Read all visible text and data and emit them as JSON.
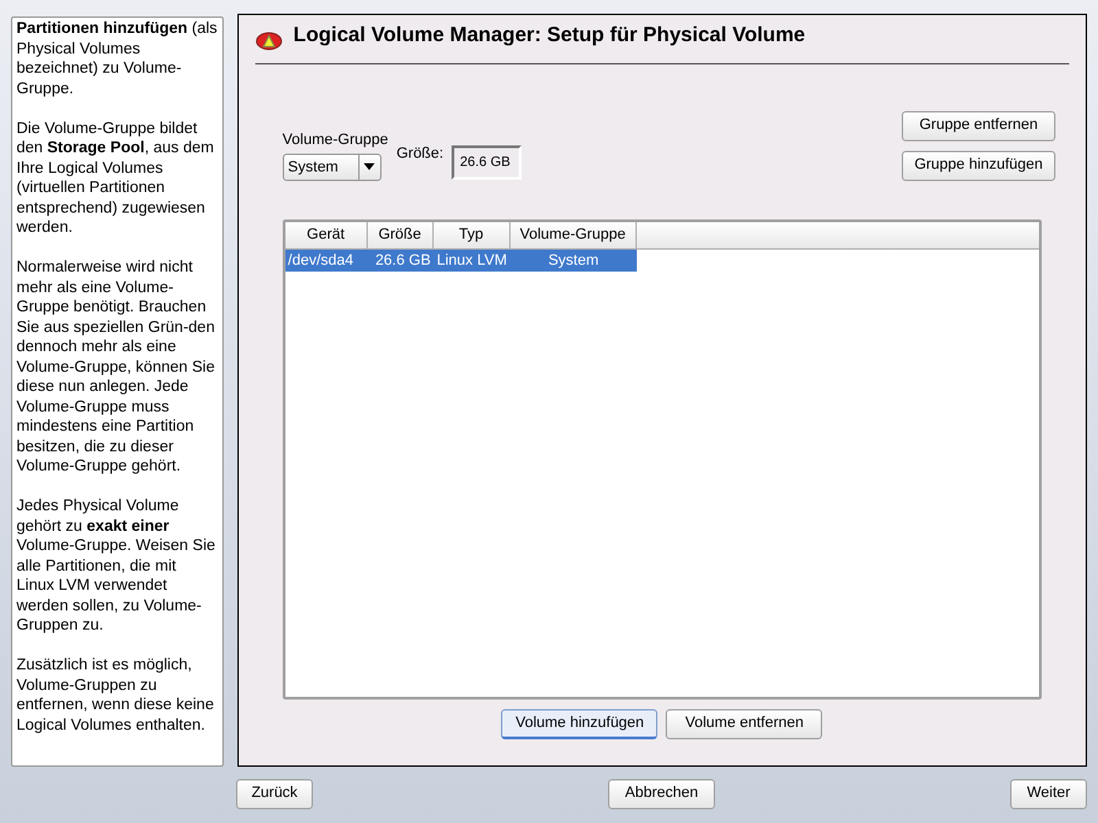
{
  "help": {
    "paragraphs": [
      "**Partitionen hinzufügen** (als Physical Volumes bezeichnet) zu Volume-Gruppe.",
      "Die Volume-Gruppe bildet den **Storage Pool**, aus dem Ihre Logical Volumes (virtuellen Partitionen entsprechend) zugewiesen werden.",
      "Normalerweise wird nicht mehr als eine Volume-Gruppe benötigt. Brauchen Sie aus speziellen Grün-den dennoch mehr als eine Volume-Gruppe, können Sie diese nun anlegen. Jede Volume-Gruppe muss mindestens eine Partition besitzen, die zu dieser Volume-Gruppe gehört.",
      "Jedes Physical Volume gehört zu **exakt einer** Volume-Gruppe. Weisen Sie alle Partitionen, die mit Linux LVM verwendet werden sollen, zu Volume-Gruppen zu.",
      "Zusätzlich ist es möglich, Volume-Gruppen zu entfernen, wenn diese keine Logical Volumes enthalten."
    ]
  },
  "dialog": {
    "title": "Logical Volume Manager: Setup für Physical Volume",
    "volume_group": {
      "label": "Volume-Gruppe",
      "value": "System"
    },
    "size": {
      "label": "Größe:",
      "value": "26.6 GB"
    },
    "group_buttons": [
      "Gruppe entfernen",
      "Gruppe hinzufügen"
    ],
    "table": {
      "columns": [
        "Gerät",
        "Größe",
        "Typ",
        "Volume-Gruppe"
      ],
      "rows": [
        {
          "cells": [
            "/dev/sda4",
            "26.6 GB",
            "Linux LVM",
            "System"
          ],
          "selected": true
        }
      ]
    },
    "volume_buttons": [
      {
        "label": "Volume hinzufügen",
        "selected": true
      },
      {
        "label": "Volume entfernen",
        "selected": false
      }
    ]
  },
  "footer": [
    "Zurück",
    "Abbrechen",
    "Weiter"
  ]
}
